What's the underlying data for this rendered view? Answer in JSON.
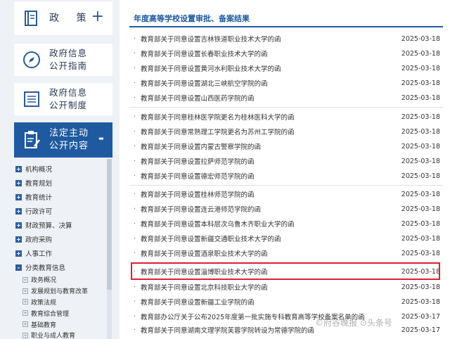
{
  "sidebar": {
    "policy_label": "政 策",
    "policy_plus": "+",
    "guide_line1": "政府信息",
    "guide_line2": "公开指南",
    "system_line1": "政府信息",
    "system_line2": "公开制度",
    "legal_line1": "法定主动",
    "legal_line2": "公开内容",
    "legal_minus": "-",
    "tree": [
      {
        "mark": "+",
        "label": "机构概况"
      },
      {
        "mark": "+",
        "label": "教育规划"
      },
      {
        "mark": "+",
        "label": "教育统计"
      },
      {
        "mark": "+",
        "label": "行政许可"
      },
      {
        "mark": "+",
        "label": "财政预算、决算"
      },
      {
        "mark": "+",
        "label": "政府采购"
      },
      {
        "mark": "+",
        "label": "人事工作"
      },
      {
        "mark": "-",
        "label": "分类教育信息"
      }
    ],
    "subtree": [
      {
        "mark": "+",
        "label": "政务概况"
      },
      {
        "mark": "+",
        "label": "发展规划与教育改革"
      },
      {
        "mark": "+",
        "label": "政策法规"
      },
      {
        "mark": "+",
        "label": "教育综合管理"
      },
      {
        "mark": "+",
        "label": "基础教育"
      },
      {
        "mark": "+",
        "label": "职业与成人教育"
      }
    ]
  },
  "main": {
    "section_title": "年度高等学校设置审批、备案结果",
    "bullet": "·",
    "rows": [
      {
        "title": "教育部关于同意设置吉林铁道职业技术大学的函",
        "date": "2025-03-18"
      },
      {
        "title": "教育部关于同意设置长春职业技术大学的函",
        "date": "2025-03-18"
      },
      {
        "title": "教育部关于同意设置黄河水利职业技术大学的函",
        "date": "2025-03-18"
      },
      {
        "title": "教育部关于同意设置湖北三峡航空学院的函",
        "date": "2025-03-18"
      },
      {
        "title": "教育部关于同意设置山西医药学院的函",
        "date": "2025-03-18"
      },
      {
        "title": "教育部关于同意桂林医学院更名为桂林医科大学的函",
        "date": "2025-03-18"
      },
      {
        "title": "教育部关于同意常熟理工学院更名为苏州工学院的函",
        "date": "2025-03-18"
      },
      {
        "title": "教育部关于同意设置内蒙古警察学院的函",
        "date": "2025-03-18"
      },
      {
        "title": "教育部关于同意设置拉萨师范学院的函",
        "date": "2025-03-18"
      },
      {
        "title": "教育部关于同意设置德宏师范学院的函",
        "date": "2025-03-18"
      },
      {
        "title": "教育部关于同意设置桂林师范学院的函",
        "date": "2025-03-18"
      },
      {
        "title": "教育部关于同意设置连云港师范学院的函",
        "date": "2025-03-18"
      },
      {
        "title": "教育部关于同意设置本科层次乌鲁木齐职业大学的函",
        "date": "2025-03-18"
      },
      {
        "title": "教育部关于同意设置新疆交通职业技术大学的函",
        "date": "2025-03-18"
      },
      {
        "title": "教育部关于同意设置酒泉职业技术大学的函",
        "date": "2025-03-18"
      },
      {
        "title": "教育部关于同意设置淄博职业技术大学的函",
        "date": "2025-03-18"
      },
      {
        "title": "教育部关于同意设置北京科技职业大学的函",
        "date": "2025-03-18"
      },
      {
        "title": "教育部关于同意设置新疆工业学院的函",
        "date": "2025-03-18"
      },
      {
        "title": "教育部办公厅关于公布2025年度第一批实施专科教育高等学校备案名单的函",
        "date": "2025-03-17"
      },
      {
        "title": "教育部关于同意湖南文理学院芙蓉学院转设为常德学院的函",
        "date": "2025-03-17"
      }
    ]
  },
  "watermark": "©府谷晚报 ⊙头条号",
  "colors": {
    "accent": "#1f5aa0",
    "highlight_border": "#d9232e",
    "background": "#eef1f5"
  }
}
